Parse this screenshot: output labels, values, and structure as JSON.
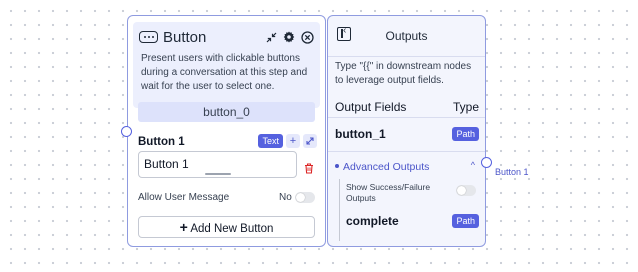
{
  "node": {
    "title": "Button",
    "description": "Present users with clickable buttons during a conversation at this step and wait for the user to select one.",
    "variable_name": "button_0",
    "icons": [
      "button-icon",
      "collapse-arrows-icon",
      "gear-icon",
      "close-icon"
    ],
    "button": {
      "label": "Button 1",
      "type_badge": "Text",
      "value": "Button 1"
    },
    "allow_user_message": {
      "label": "Allow User Message",
      "value": "No",
      "enabled": false
    },
    "add_button_label": "Add New Button"
  },
  "outputs": {
    "title": "Outputs",
    "description": "Type \"{{\" in downstream nodes to leverage output fields.",
    "col_fields": "Output Fields",
    "col_type": "Type",
    "fields": [
      {
        "name": "button_1",
        "type": "Path"
      },
      {
        "name": "complete",
        "type": "Path"
      }
    ],
    "advanced_label": "Advanced Outputs",
    "show_success_failure_label": "Show Success/Failure Outputs",
    "show_success_failure_enabled": false
  },
  "handle": {
    "right_label": "Button 1"
  },
  "colors": {
    "accent": "#5561df",
    "node_border": "#8f9be0",
    "header_bg": "#eceffd"
  }
}
